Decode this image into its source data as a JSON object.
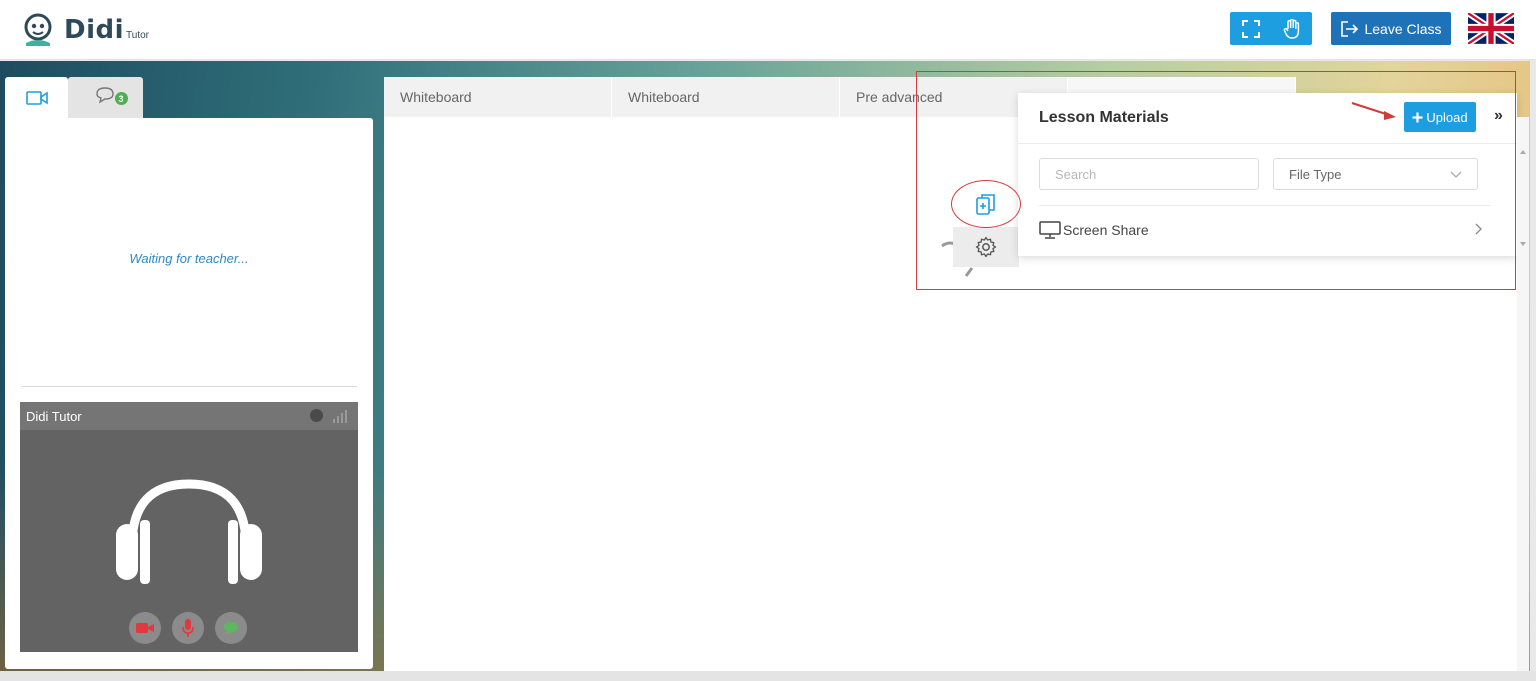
{
  "header": {
    "logo_text": "Didi",
    "logo_sub": "Tutor",
    "leave_label": "Leave Class",
    "icons": [
      "fullscreen-icon",
      "hand-raise-icon",
      "exit-icon",
      "uk-flag-icon"
    ]
  },
  "left": {
    "tab_icons": [
      "video-camera-icon",
      "chat-icon"
    ],
    "chat_count": "3",
    "waiting_text": "Waiting for teacher...",
    "video_name": "Didi Tutor",
    "controls": [
      "camera-icon",
      "microphone-icon",
      "chat-bubble-icon"
    ]
  },
  "whiteboard": {
    "tabs": [
      {
        "label": "Whiteboard"
      },
      {
        "label": "Whiteboard"
      },
      {
        "label": "Pre advanced"
      }
    ]
  },
  "lesson_materials": {
    "title": "Lesson Materials",
    "upload_label": "Upload",
    "collapse_label": "»",
    "search_placeholder": "Search",
    "file_type_label": "File Type",
    "screen_share_label": "Screen Share"
  },
  "colors": {
    "primary_blue": "#1d9ee0",
    "leave_blue": "#1e73b8",
    "annotation_red": "#d33a3a",
    "badge_green": "#4caf50",
    "camera_red": "#e0393e",
    "chat_green": "#5cb85c"
  }
}
